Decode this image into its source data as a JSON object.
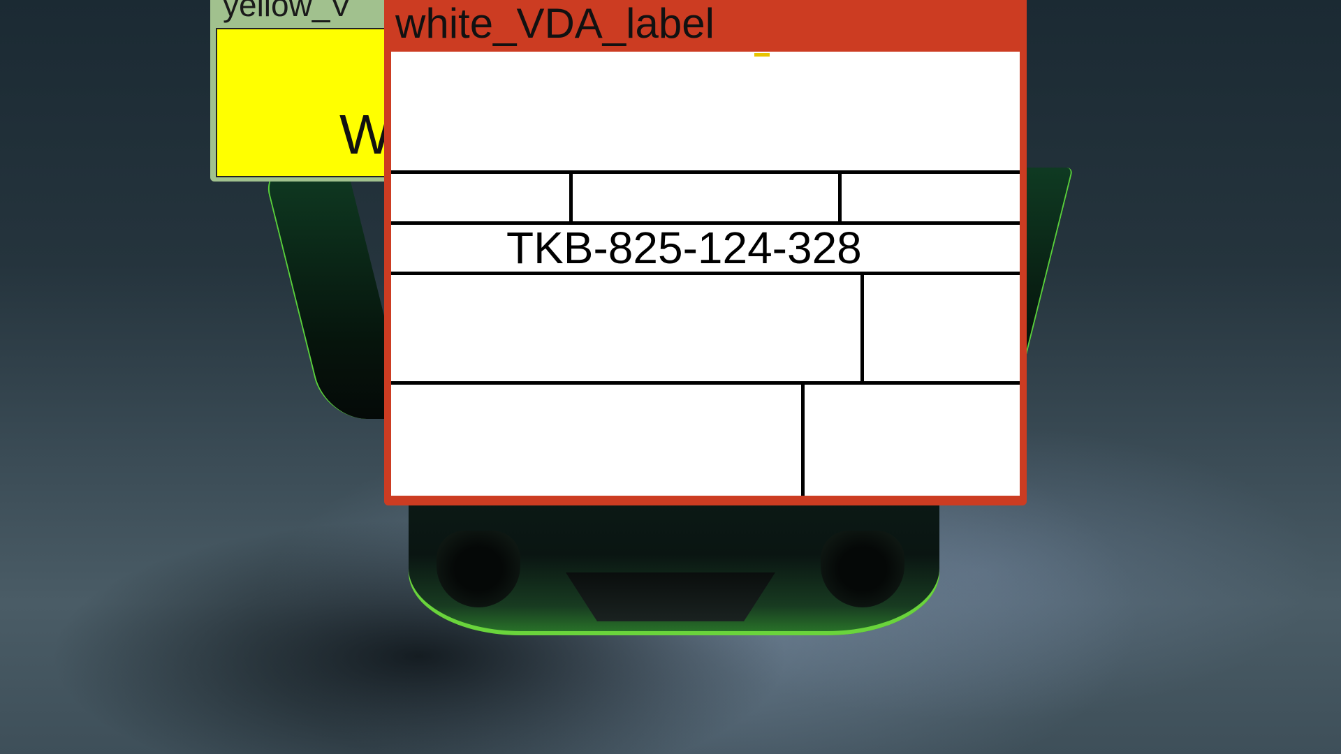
{
  "background": {
    "accent_green": "#59d23a",
    "scene": "car-front"
  },
  "yellow_window": {
    "title": "yellow_V",
    "body_text": "W",
    "frame_color": "#a1c18e",
    "body_color": "#ffff00"
  },
  "vda_window": {
    "title": "white_VDA_label",
    "frame_color": "#cc3c22",
    "rows": [
      {
        "cells": [
          ""
        ]
      },
      {
        "cells": [
          "",
          "",
          ""
        ]
      },
      {
        "cells": [
          "TKB-825-124-328"
        ]
      },
      {
        "cells": [
          "",
          ""
        ]
      },
      {
        "cells": [
          "",
          ""
        ]
      }
    ]
  }
}
